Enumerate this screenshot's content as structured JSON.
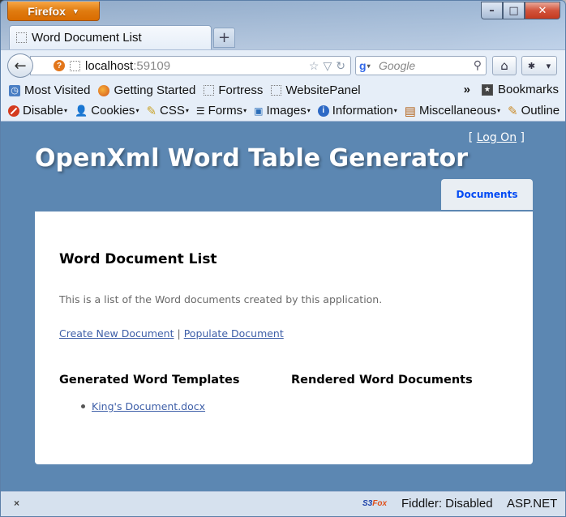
{
  "browser": {
    "menu_button": "Firefox",
    "tab_title": "Word Document List",
    "new_tab": "+",
    "url_host": "localhost",
    "url_port": ":59109",
    "search_placeholder": "Google",
    "bookmarks": [
      "Most Visited",
      "Getting Started",
      "Fortress",
      "WebsitePanel"
    ],
    "bookmarks_menu": "Bookmarks",
    "bookmarks_overflow": "»",
    "webdev_toolbar": [
      "Disable",
      "Cookies",
      "CSS",
      "Forms",
      "Images",
      "Information",
      "Miscellaneous",
      "Outline"
    ]
  },
  "page": {
    "logon_prefix": "[",
    "logon_link": "Log On",
    "logon_suffix": "]",
    "site_title": "OpenXml Word Table Generator",
    "menu_tab": "Documents",
    "heading": "Word Document List",
    "intro": "This is a list of the Word documents created by this application.",
    "link_create": "Create New Document",
    "link_separator": "|",
    "link_populate": "Populate Document",
    "col_templates_title": "Generated Word Templates",
    "templates": [
      "King's Document.docx"
    ],
    "col_rendered_title": "Rendered Word Documents"
  },
  "statusbar": {
    "close": "×",
    "s3": "S3",
    "fox": "Fox",
    "fiddler": "Fiddler: Disabled",
    "aspnet": "ASP.NET"
  },
  "colors": {
    "site_background": "#5c87b2",
    "link": "#3e5fa8",
    "menu_tab_text": "#034af3",
    "firefox_orange": "#e07b10"
  }
}
